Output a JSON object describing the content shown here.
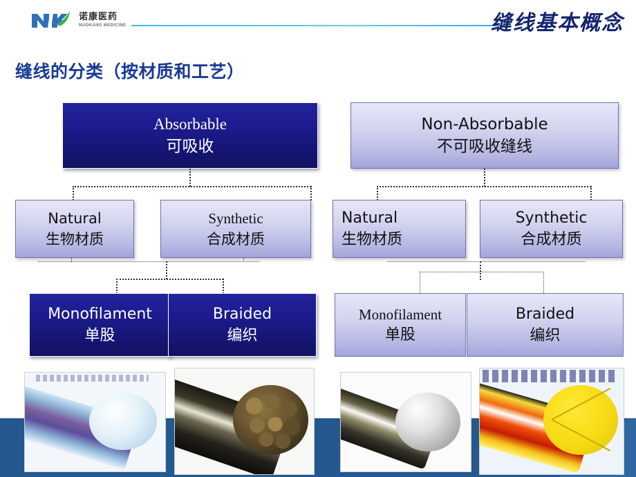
{
  "header": {
    "logo": {
      "mark": "nk-logo-icon",
      "cn_name": "诺康医药",
      "en_name": "NUOKANG MEDICINE"
    },
    "title": "缝线基本概念",
    "rule_color": "#3fb7ef",
    "title_color": "#14246e"
  },
  "subtitle": {
    "text": "缝线的分类（按材质和工艺）",
    "color": "#173a93"
  },
  "diagram": {
    "left_tree": {
      "root": {
        "en": "Absorbable",
        "cn": "可吸收",
        "style": "dark"
      },
      "level2": [
        {
          "en": "Natural",
          "cn": "生物材质",
          "style": "light"
        },
        {
          "en": "Synthetic",
          "cn": "合成材质",
          "style": "light"
        }
      ],
      "level3": [
        {
          "en": "Monofilament",
          "cn": "单股",
          "style": "dark"
        },
        {
          "en": "Braided",
          "cn": "编织",
          "style": "dark"
        }
      ]
    },
    "right_tree": {
      "root": {
        "en": "Non-Absorbable",
        "cn": "不可吸收缝线",
        "style": "light"
      },
      "level2": [
        {
          "en": "Natural",
          "cn": "生物材质",
          "style": "light"
        },
        {
          "en": "Synthetic",
          "cn": "合成材质",
          "style": "light"
        }
      ],
      "level3": [
        {
          "en": "Monofilament",
          "cn": "单股",
          "style": "light"
        },
        {
          "en": "Braided",
          "cn": "编织",
          "style": "light"
        }
      ]
    },
    "colors": {
      "dark_box_top": "#23239b",
      "dark_box_bottom": "#121263",
      "light_box_top": "#e6e7f7",
      "light_box_bottom": "#a3a4da",
      "light_box_border": "#6f6fae",
      "connector": "#2a2a2a"
    }
  },
  "photos": [
    {
      "name": "monofilament-absorbable-photo",
      "alt": "blue monofilament suture cross-section"
    },
    {
      "name": "braided-absorbable-photo",
      "alt": "braided suture cross-section showing multiple strands"
    },
    {
      "name": "monofilament-nonabsorbable-photo",
      "alt": "steel monofilament suture cross-section"
    },
    {
      "name": "braided-nonabsorbable-photo",
      "alt": "yellow braided suture cross-section"
    }
  ],
  "footer": {
    "band_color": "#24588f",
    "wedge_color": "#2f67a1"
  }
}
